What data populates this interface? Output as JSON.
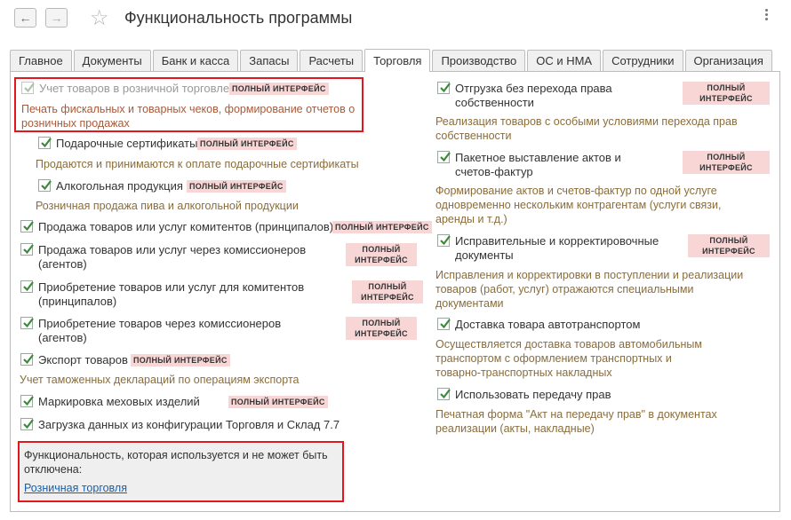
{
  "window": {
    "title": "Функциональность программы"
  },
  "nav": {
    "back": "←",
    "forward": "→",
    "star": "☆"
  },
  "tabs": [
    "Главное",
    "Документы",
    "Банк и касса",
    "Запасы",
    "Расчеты",
    "Торговля",
    "Производство",
    "ОС и НМА",
    "Сотрудники",
    "Организация"
  ],
  "active_tab": "Торговля",
  "badge": "ПОЛНЫЙ ИНТЕРФЕЙС",
  "badge_l1": "ПОЛНЫЙ",
  "badge_l2": "ИНТЕРФЕЙС",
  "left": {
    "retail": {
      "label": "Учет товаров в розничной торговле",
      "desc": "Печать фискальных и товарных чеков, формирование отчетов о розничных продажах",
      "checked": true,
      "disabled": true
    },
    "gift": {
      "label": "Подарочные сертификаты",
      "desc": "Продаются и принимаются к оплате подарочные сертификаты",
      "checked": true
    },
    "alcohol": {
      "label": "Алкогольная продукция",
      "desc": "Розничная продажа пива и алкогольной продукции",
      "checked": true
    },
    "committents": {
      "label": "Продажа товаров или услуг комитентов (принципалов)",
      "checked": true
    },
    "agents": {
      "label1": "Продажа товаров или услуг через комиссионеров",
      "label2": "(агентов)",
      "checked": true
    },
    "purchase_committents": {
      "label1": "Приобретение товаров или услуг для комитентов",
      "label2": "(принципалов)",
      "checked": true
    },
    "purchase_agents": {
      "label1": "Приобретение товаров через комиссионеров",
      "label2": "(агентов)",
      "checked": true
    },
    "export": {
      "label": "Экспорт товаров",
      "desc": "Учет таможенных деклараций по операциям экспорта",
      "checked": true
    },
    "fur": {
      "label": "Маркировка меховых изделий",
      "checked": true
    },
    "load": {
      "label": "Загрузка данных из конфигурации Торговля и Склад 7.7",
      "checked": true
    }
  },
  "info": {
    "text1": "Функциональность, которая используется и не может быть",
    "text2": "отключена:",
    "link": "Розничная торговля"
  },
  "right": {
    "shipment": {
      "label1": "Отгрузка без перехода права",
      "label2": "собственности",
      "desc1": "Реализация товаров с особыми условиями перехода прав",
      "desc2": "собственности",
      "checked": true
    },
    "batch": {
      "label1": "Пакетное выставление актов и",
      "label2": "счетов-фактур",
      "desc1": "Формирование актов и счетов-фактур по одной услуге",
      "desc2": "одновременно нескольким контрагентам (услуги связи,",
      "desc3": "аренды и т.д.)",
      "checked": true
    },
    "corrective": {
      "label1": "Исправительные и корректировочные",
      "label2": "документы",
      "desc1": "Исправления и корректировки в поступлении и реализации",
      "desc2": "товаров (работ, услуг) отражаются специальными",
      "desc3": "документами",
      "checked": true
    },
    "delivery": {
      "label": "Доставка товара автотранспортом",
      "desc1": "Осуществляется доставка товаров автомобильным",
      "desc2": "транспортом с оформлением транспортных и",
      "desc3": "товарно-транспортных накладных",
      "checked": true
    },
    "transfer": {
      "label": "Использовать передачу прав",
      "desc1": "Печатная форма \"Акт на передачу прав\" в документах",
      "desc2": "реализации (акты, накладные)",
      "checked": true
    }
  },
  "colors": {
    "highlight": "#e3161e",
    "badge_bg": "#f9d6d6",
    "check": "#3a8a3a",
    "link": "#1a5ea7"
  }
}
